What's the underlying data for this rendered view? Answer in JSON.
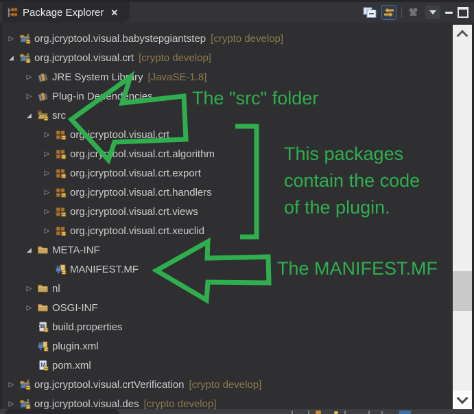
{
  "window": {
    "tab_title": "Package Explorer",
    "close_glyph": "✕"
  },
  "toolbar": {
    "icons": [
      "collapse-all-icon",
      "link-with-editor-icon",
      "focus-disabled-icon",
      "view-menu-icon",
      "minimize-icon",
      "maximize-icon"
    ],
    "link_with_editor_active": true
  },
  "colors": {
    "annotation_green": "#2fae4e",
    "decoration_olive": "#8d7b4b",
    "tree_background": "#2f2f32",
    "tree_text": "#cccccc"
  },
  "tree": {
    "rows": [
      {
        "indent": 0,
        "twistie": "collapsed",
        "icon": "plugin-project-icon",
        "label": "org.jcryptool.visual.babystepgiantstep",
        "decoration": "[crypto develop]"
      },
      {
        "indent": 0,
        "twistie": "expanded",
        "icon": "plugin-project-icon",
        "label": "org.jcryptool.visual.crt",
        "decoration": "[crypto develop]"
      },
      {
        "indent": 1,
        "twistie": "collapsed",
        "icon": "library-icon",
        "label": "JRE System Library",
        "decoration": "[JavaSE-1.8]"
      },
      {
        "indent": 1,
        "twistie": "collapsed",
        "icon": "library-icon",
        "label": "Plug-in Dependencies",
        "decoration": ""
      },
      {
        "indent": 1,
        "twistie": "expanded",
        "icon": "source-folder-icon",
        "label": "src",
        "decoration": ""
      },
      {
        "indent": 2,
        "twistie": "collapsed",
        "icon": "package-icon",
        "label": "org.jcryptool.visual.crt",
        "decoration": ""
      },
      {
        "indent": 2,
        "twistie": "collapsed",
        "icon": "package-icon",
        "label": "org.jcryptool.visual.crt.algorithm",
        "decoration": ""
      },
      {
        "indent": 2,
        "twistie": "collapsed",
        "icon": "package-icon",
        "label": "org.jcryptool.visual.crt.export",
        "decoration": ""
      },
      {
        "indent": 2,
        "twistie": "collapsed",
        "icon": "package-icon",
        "label": "org.jcryptool.visual.crt.handlers",
        "decoration": ""
      },
      {
        "indent": 2,
        "twistie": "collapsed",
        "icon": "package-icon",
        "label": "org.jcryptool.visual.crt.views",
        "decoration": ""
      },
      {
        "indent": 2,
        "twistie": "collapsed",
        "icon": "package-icon",
        "label": "org.jcryptool.visual.crt.xeuclid",
        "decoration": ""
      },
      {
        "indent": 1,
        "twistie": "expanded",
        "icon": "folder-icon",
        "label": "META-INF",
        "decoration": ""
      },
      {
        "indent": 2,
        "twistie": "none",
        "icon": "manifest-file-icon",
        "label": "MANIFEST.MF",
        "decoration": ""
      },
      {
        "indent": 1,
        "twistie": "collapsed",
        "icon": "folder-icon",
        "label": "nl",
        "decoration": ""
      },
      {
        "indent": 1,
        "twistie": "collapsed",
        "icon": "folder-icon",
        "label": "OSGI-INF",
        "decoration": ""
      },
      {
        "indent": 1,
        "twistie": "none",
        "icon": "properties-file-icon",
        "label": "build.properties",
        "decoration": ""
      },
      {
        "indent": 1,
        "twistie": "none",
        "icon": "plugin-xml-icon",
        "label": "plugin.xml",
        "decoration": ""
      },
      {
        "indent": 1,
        "twistie": "none",
        "icon": "pom-xml-icon",
        "label": "pom.xml",
        "decoration": ""
      },
      {
        "indent": 0,
        "twistie": "collapsed",
        "icon": "plugin-project-icon",
        "label": "org.jcryptool.visual.crtVerification",
        "decoration": "[crypto develop]"
      },
      {
        "indent": 0,
        "twistie": "collapsed",
        "icon": "plugin-project-icon",
        "label": "org.jcryptool.visual.des",
        "decoration": "[crypto develop]"
      }
    ]
  },
  "annotations": {
    "src_label": "The \"src\" folder",
    "packages_note_lines": [
      "This packages",
      "contain the code",
      "of the plugin."
    ],
    "manifest_label": "The MANIFEST.MF"
  }
}
